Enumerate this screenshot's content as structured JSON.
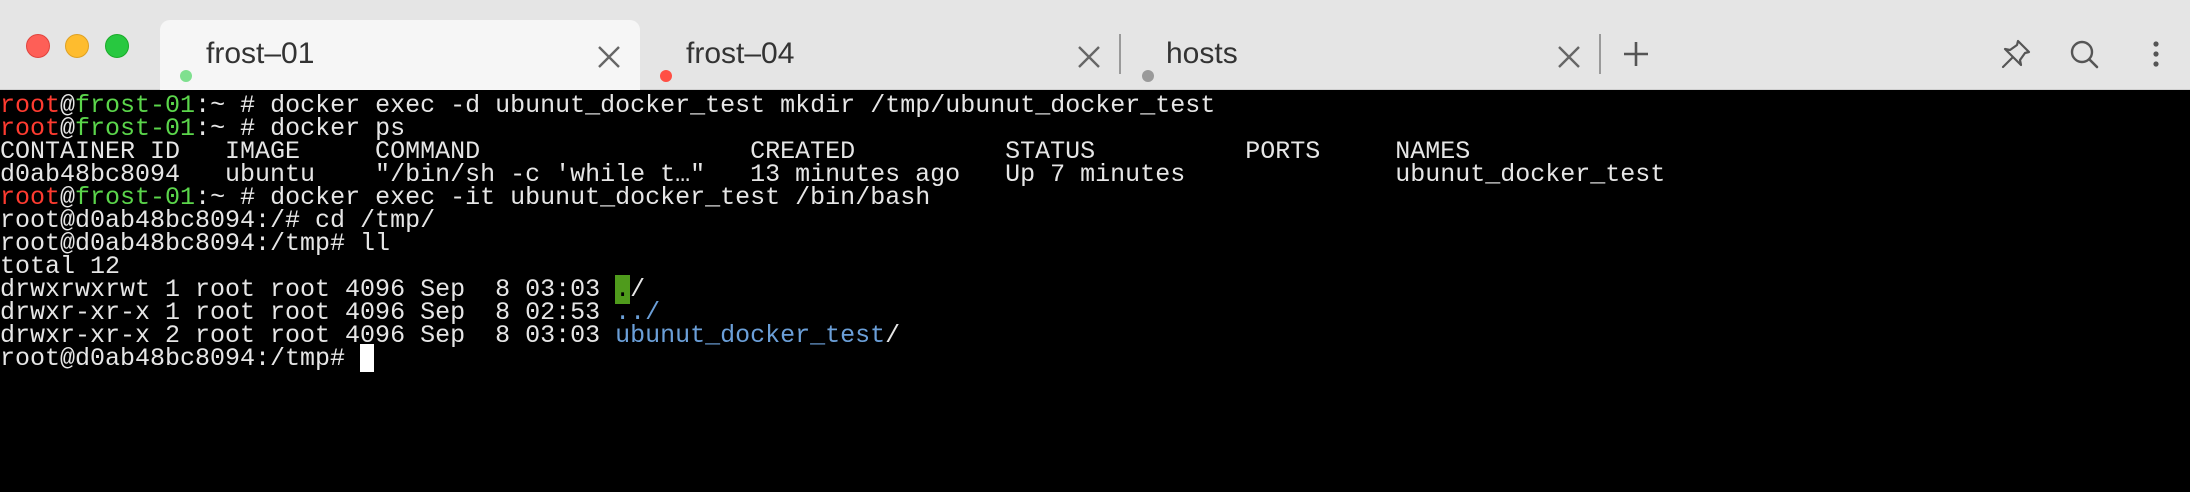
{
  "tabs": [
    {
      "label": "frost–01",
      "dot_color": "#7fe08f",
      "active": true
    },
    {
      "label": "frost–04",
      "dot_color": "#ff4f44",
      "active": false
    },
    {
      "label": "hosts",
      "dot_color": "#9a9a9a",
      "active": false
    }
  ],
  "toolbar": {
    "new_tab": "+"
  },
  "prompt": {
    "user": "root",
    "at": "@",
    "host": "frost-01",
    "path": ":~",
    "symbol": " # "
  },
  "lines": {
    "l1_cmd": "docker exec -d ubunut_docker_test mkdir /tmp/ubunut_docker_test",
    "l2_cmd": "docker ps",
    "l3": "CONTAINER ID   IMAGE     COMMAND                  CREATED          STATUS          PORTS     NAMES",
    "l4": "d0ab48bc8094   ubuntu    \"/bin/sh -c 'while t…\"   13 minutes ago   Up 7 minutes              ubunut_docker_test",
    "l5_cmd": "docker exec -it ubunut_docker_test /bin/bash",
    "l6": "root@d0ab48bc8094:/# cd /tmp/",
    "l7": "root@d0ab48bc8094:/tmp# ll",
    "l8": "total 12",
    "l9_prefix": "drwxrwxrwt 1 root root 4096 Sep  8 03:03 ",
    "l9_dir": ".",
    "l9_suffix": "/",
    "l10_prefix": "drwxr-xr-x 1 root root 4096 Sep  8 02:53 ",
    "l10_dir": "../",
    "l11_prefix": "drwxr-xr-x 2 root root 4096 Sep  8 03:03 ",
    "l11_dir": "ubunut_docker_test",
    "l11_suffix": "/",
    "l12_prompt": "root@d0ab48bc8094:/tmp# "
  }
}
